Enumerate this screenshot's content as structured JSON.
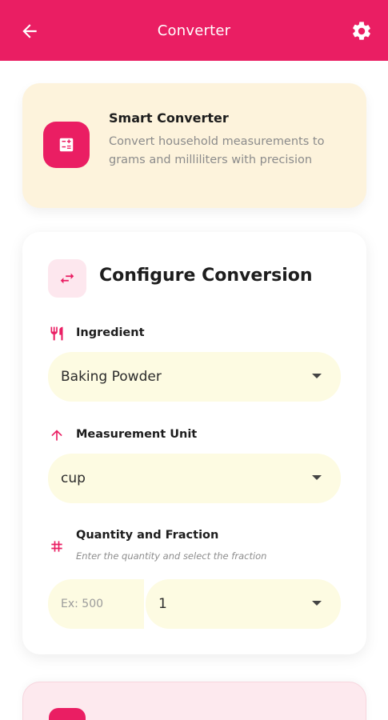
{
  "appbar": {
    "title": "Converter",
    "color": "#ea1e63"
  },
  "info": {
    "title": "Smart Converter",
    "description": "Convert household measurements to grams and milliliters with precision",
    "background": "#fdf3dc"
  },
  "config": {
    "title": "Configure Conversion",
    "ingredient": {
      "label": "Ingredient",
      "value": "Baking Powder",
      "icon": "fork-knife-icon"
    },
    "unit": {
      "label": "Measurement Unit",
      "value": "cup",
      "icon": "arrow-up-icon"
    },
    "quantity": {
      "label": "Quantity and Fraction",
      "hint": "Enter the quantity and select the fraction",
      "placeholder": "Ex: 500",
      "fraction_value": "1",
      "icon": "hash-icon"
    }
  },
  "colors": {
    "accent": "#ea1e63",
    "field_bg": "#fdfbe2"
  }
}
